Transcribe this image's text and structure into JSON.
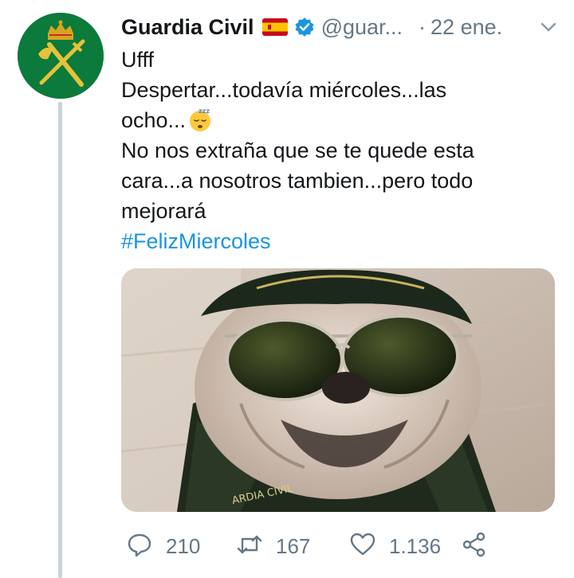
{
  "tweet": {
    "author_name": "Guardia Civil",
    "handle": "@guar...",
    "separator": "·",
    "timestamp": "22 ene.",
    "lines": [
      "Ufff",
      "Despertar...todavía miércoles...las",
      "ocho...",
      "No nos extraña que se te quede esta",
      "cara...a nosotros tambien...pero todo",
      "mejorará"
    ],
    "hashtag": "#FelizMiercoles",
    "icons": {
      "flag": "spain-flag-icon",
      "verified": "verified-badge-icon",
      "menu": "chevron-down-icon",
      "emoji": "sleeping-face-emoji",
      "reply": "reply-icon",
      "retweet": "retweet-icon",
      "like": "heart-icon",
      "share": "share-icon"
    },
    "colors": {
      "accent": "#1b95e0",
      "secondary_text": "#657786",
      "avatar_bg": "#0b7a3b"
    }
  },
  "media": {
    "uniform_text": "ARDIA CIVIL"
  },
  "actions": {
    "replies": "210",
    "retweets": "167",
    "likes": "1.136"
  }
}
